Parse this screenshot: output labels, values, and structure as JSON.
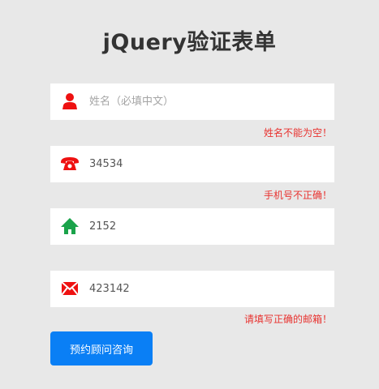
{
  "form": {
    "title": "jQuery验证表单",
    "fields": [
      {
        "icon": "user-icon",
        "icon_color": "#ee1111",
        "value": "",
        "placeholder": "姓名（必填中文）",
        "error": "姓名不能为空！"
      },
      {
        "icon": "phone-icon",
        "icon_color": "#ee1111",
        "value": "34534",
        "placeholder": "",
        "error": "手机号不正确！"
      },
      {
        "icon": "home-icon",
        "icon_color": "#1aa34a",
        "value": "2152",
        "placeholder": "",
        "error": ""
      },
      {
        "icon": "email-icon",
        "icon_color": "#ee1111",
        "value": "423142",
        "placeholder": "",
        "error": "请填写正确的邮箱！"
      }
    ],
    "submit_label": "预约顾问咨询"
  },
  "colors": {
    "background": "#e8e8e8",
    "error_text": "#e8322f",
    "button": "#0a7ff5"
  }
}
